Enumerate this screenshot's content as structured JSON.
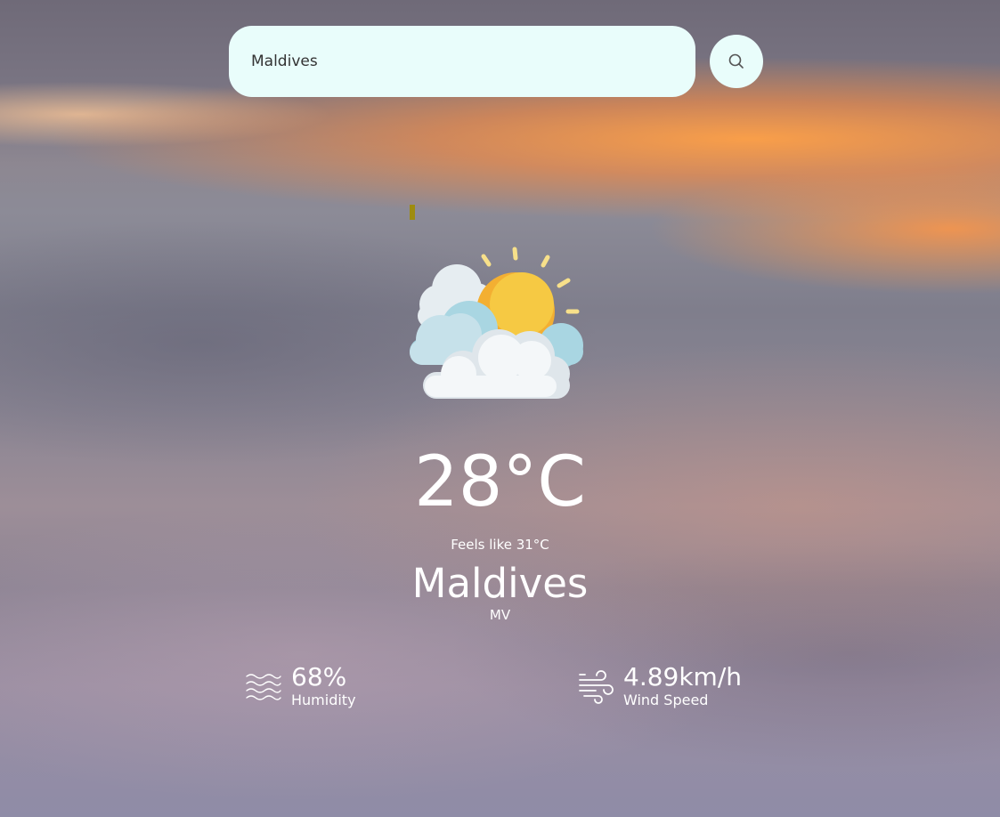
{
  "search": {
    "value": "Maldives",
    "button_icon": "search-icon"
  },
  "weather": {
    "icon": "partly-cloudy-sun-icon",
    "temperature": "28°C",
    "feels_like": "Feels like 31°C",
    "city": "Maldives",
    "country": "MV"
  },
  "stats": {
    "humidity": {
      "value": "68%",
      "label": "Humidity",
      "icon": "humidity-waves-icon"
    },
    "wind": {
      "value": "4.89km/h",
      "label": "Wind Speed",
      "icon": "wind-icon"
    }
  },
  "colors": {
    "search_background": "#e9fdfb",
    "text": "#ffffff",
    "sun": "#f6b93b"
  }
}
